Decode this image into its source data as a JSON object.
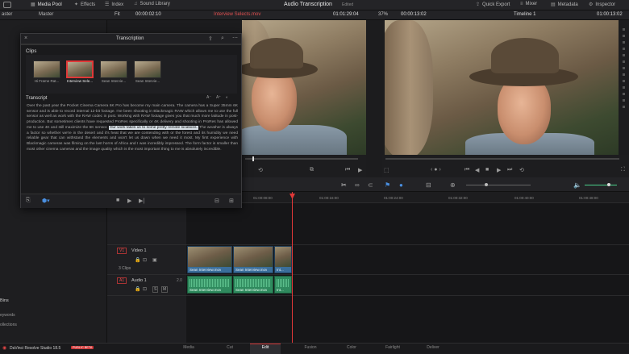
{
  "topbar": {
    "media_pool": "Media Pool",
    "effects": "Effects",
    "index": "Index",
    "sound_library": "Sound Library",
    "app_title": "Audio Transcription",
    "app_subtitle": "Edited",
    "quick_export": "Quick Export",
    "mixer": "Mixer",
    "metadata": "Metadata",
    "inspector": "Inspector"
  },
  "viewer_header": {
    "bin_left": "aster",
    "bin_right": "Master",
    "fit": "Fit",
    "source_timecode": "00:00:02:10",
    "clip_name": "Interview Selects.mov",
    "source_duration": "01:01:29:04",
    "zoom": "37%",
    "timeline_duration": "00:00:13:02",
    "timeline_name": "Timeline 1",
    "record_timecode": "01:00:13:02"
  },
  "transcription": {
    "window_title": "Transcription",
    "clips_label": "Clips",
    "clips": [
      {
        "label": "Hi Frame Rat..."
      },
      {
        "label": "Interview Sele..."
      },
      {
        "label": "Sean Intervie..."
      },
      {
        "label": "Sean Intervie..."
      }
    ],
    "transcript_label": "Transcript",
    "text_before": "Over the past year the Pocket Cinema Camera 6K Pro has become my main camera. The camera has a Super 35mm 6K sensor and is able to record internal 12-bit footage. I've been shooting in Blackmagic RAW which allows me to use the full sensor as well as work with the RAW codec in post. Working with RAW footage gives you that much more latitude in post-production. But sometimes clients have requested ProRes specifically or 4K delivery and shooting in ProRes has allowed me to use 4K and still maximize the 6K sensor.",
    "text_highlight": "Our work takes us to some pretty remote locations.",
    "text_after": "The weather is always a factor so whether we're in the desert and it's heat that we are contending with or the forest and its humidity we need reliable gear that can withstand the elements and won't let us down when we need it most. My first experience with Blackmagic cameras was filming on the last horns of Africa and I was incredibly impressed. The form factor is smaller than most other cinema cameras and the image quality which is the most important thing to me is absolutely incredible."
  },
  "timeline": {
    "ruler_ticks": [
      "01:00:08:00",
      "01:00:16:00",
      "01:00:24:00",
      "01:00:32:00",
      "01:00:40:00",
      "01:00:48:00"
    ],
    "video_track_id": "V1",
    "video_track_name": "Video 1",
    "video_clip_count": "3 Clips",
    "audio_track_id": "A1",
    "audio_track_name": "Audio 1",
    "audio_channel": "2.0",
    "video_clips": [
      "Sean Interview.mov",
      "Sean Interview.mov",
      "Int..."
    ],
    "audio_clips": [
      "Sean Interview.mov",
      "Sean Interview.mov",
      "Int..."
    ]
  },
  "left_panel": {
    "bins_label": "Bins",
    "keywords_label": "eywords",
    "collections_label": "ollections"
  },
  "bottom": {
    "app_version": "DaVinci Resolve Studio 18.5",
    "beta_badge": "PUBLIC BETA",
    "pages": [
      "Media",
      "Cut",
      "Edit",
      "Fusion",
      "Color",
      "Fairlight",
      "Deliver"
    ],
    "active_page": "Edit"
  },
  "colors": {
    "accent_red": "#e03838",
    "video_clip": "#3a6e9a",
    "audio_clip": "#2f8a5e",
    "highlight": "#d8e0e6"
  }
}
